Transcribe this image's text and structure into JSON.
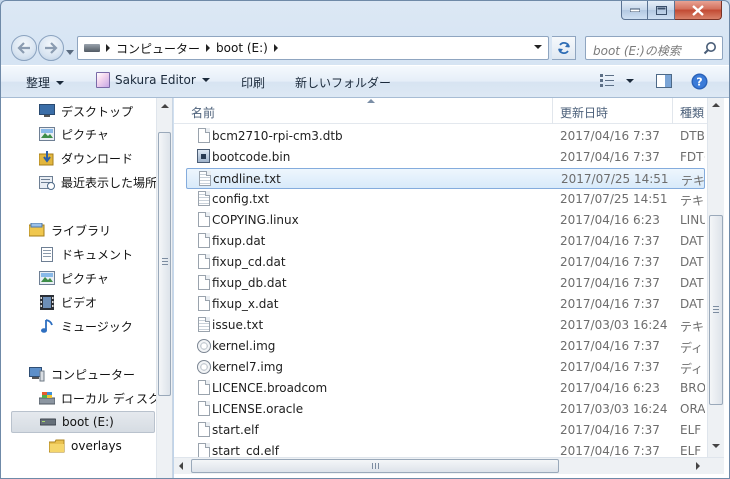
{
  "address": {
    "crumbs": [
      "コンピューター",
      "boot (E:)"
    ]
  },
  "search": {
    "placeholder": "boot (E:)の検索"
  },
  "toolbar": {
    "organize": "整理",
    "open_with": "Sakura Editor",
    "print": "印刷",
    "new_folder": "新しいフォルダー"
  },
  "navpane": {
    "favorites": [
      "デスクトップ",
      "ピクチャ",
      "ダウンロード",
      "最近表示した場所"
    ],
    "libraries_label": "ライブラリ",
    "libraries": [
      "ドキュメント",
      "ピクチャ",
      "ビデオ",
      "ミュージック"
    ],
    "computer_label": "コンピューター",
    "drives": [
      "ローカル ディスク",
      "boot (E:)"
    ],
    "folders": [
      "overlays"
    ]
  },
  "columns": {
    "name": "名前",
    "date": "更新日時",
    "type": "種類"
  },
  "files": [
    {
      "name": "bcm2710-rpi-cm3.dtb",
      "date": "2017/04/16 7:37",
      "type": "DTB",
      "icon": "file-icon"
    },
    {
      "name": "bootcode.bin",
      "date": "2017/04/16 7:37",
      "type": "FDT+",
      "icon": "system-file-icon"
    },
    {
      "name": "cmdline.txt",
      "date": "2017/07/25 14:51",
      "type": "テキ",
      "icon": "text-file-icon"
    },
    {
      "name": "config.txt",
      "date": "2017/07/25 14:51",
      "type": "テキ",
      "icon": "text-file-icon"
    },
    {
      "name": "COPYING.linux",
      "date": "2017/04/16 6:23",
      "type": "LINU",
      "icon": "file-icon"
    },
    {
      "name": "fixup.dat",
      "date": "2017/04/16 7:37",
      "type": "DAT",
      "icon": "file-icon"
    },
    {
      "name": "fixup_cd.dat",
      "date": "2017/04/16 7:37",
      "type": "DAT",
      "icon": "file-icon"
    },
    {
      "name": "fixup_db.dat",
      "date": "2017/04/16 7:37",
      "type": "DAT",
      "icon": "file-icon"
    },
    {
      "name": "fixup_x.dat",
      "date": "2017/04/16 7:37",
      "type": "DAT",
      "icon": "file-icon"
    },
    {
      "name": "issue.txt",
      "date": "2017/03/03 16:24",
      "type": "テキ",
      "icon": "text-file-icon"
    },
    {
      "name": "kernel.img",
      "date": "2017/04/16 7:37",
      "type": "ディ",
      "icon": "disc-image-icon"
    },
    {
      "name": "kernel7.img",
      "date": "2017/04/16 7:37",
      "type": "ディ",
      "icon": "disc-image-icon"
    },
    {
      "name": "LICENCE.broadcom",
      "date": "2017/04/16 6:23",
      "type": "BRO",
      "icon": "file-icon"
    },
    {
      "name": "LICENSE.oracle",
      "date": "2017/03/03 16:24",
      "type": "ORA",
      "icon": "file-icon"
    },
    {
      "name": "start.elf",
      "date": "2017/04/16 7:37",
      "type": "ELF",
      "icon": "file-icon"
    },
    {
      "name": "start_cd.elf",
      "date": "2017/04/16 7:37",
      "type": "ELF",
      "icon": "file-icon"
    }
  ],
  "selected_file": "cmdline.txt",
  "colors": {
    "selection_border": "#84acdd",
    "close_button": "#c24a33"
  }
}
